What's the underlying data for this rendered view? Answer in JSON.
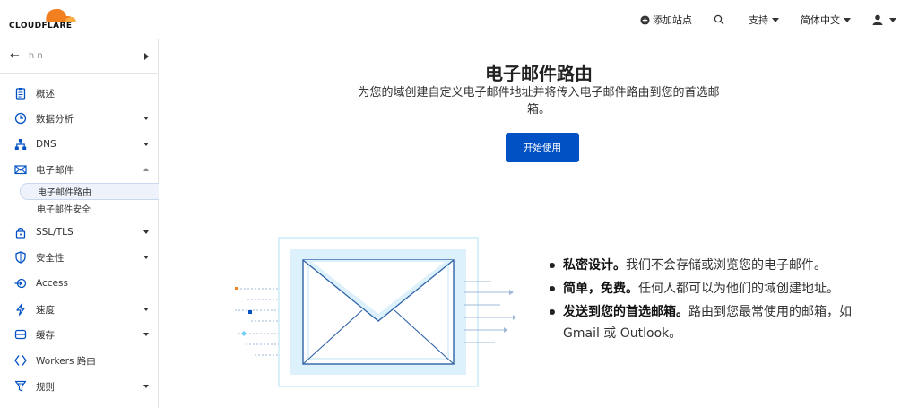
{
  "brand": {
    "name": "CLOUDFLARE",
    "orange": "#f38020",
    "orange_light": "#fbad41"
  },
  "topbar": {
    "add_site": "添加站点",
    "support": "支持",
    "language": "简体中文"
  },
  "sidebar": {
    "site_name": "h                    n",
    "items": [
      {
        "label": "概述",
        "icon": "clipboard-icon"
      },
      {
        "label": "数据分析",
        "icon": "clock-chart-icon"
      },
      {
        "label": "DNS",
        "icon": "network-icon"
      },
      {
        "label": "电子邮件",
        "icon": "envelope-icon"
      },
      {
        "label": "SSL/TLS",
        "icon": "lock-icon"
      },
      {
        "label": "安全性",
        "icon": "shield-icon"
      },
      {
        "label": "Access",
        "icon": "access-icon"
      },
      {
        "label": "速度",
        "icon": "lightning-icon"
      },
      {
        "label": "缓存",
        "icon": "database-icon"
      },
      {
        "label": "Workers 路由",
        "icon": "workers-icon"
      },
      {
        "label": "规则",
        "icon": "funnel-icon"
      }
    ],
    "email_subitems": [
      {
        "label": "电子邮件路由",
        "active": true
      },
      {
        "label": "电子邮件安全",
        "active": false
      }
    ]
  },
  "main": {
    "title": "电子邮件路由",
    "description": "为您的域创建自定义电子邮件地址并将传入电子邮件路由到您的首选邮箱。",
    "cta_label": "开始使用",
    "cta_color": "#0051c3",
    "features": [
      {
        "bold": "私密设计。",
        "text": "我们不会存储或浏览您的电子邮件。"
      },
      {
        "bold": "简单，免费。",
        "text": "任何人都可以为他们的域创建地址。"
      },
      {
        "bold": "发送到您的首选邮箱。",
        "text": "路由到您最常使用的邮箱，如 Gmail 或 Outlook。"
      }
    ]
  }
}
